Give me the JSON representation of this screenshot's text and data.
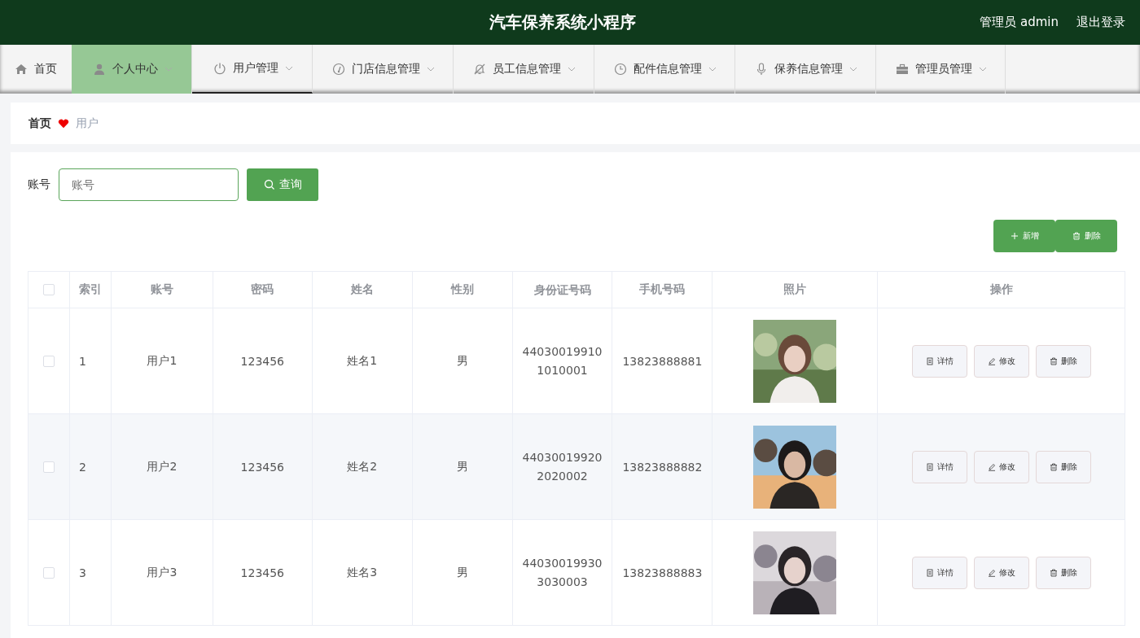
{
  "header": {
    "title": "汽车保养系统小程序",
    "user": "管理员 admin",
    "logout": "退出登录"
  },
  "nav": [
    {
      "label": "首页",
      "dropdown": false,
      "selected": false,
      "highlighted": false
    },
    {
      "label": "个人中心",
      "dropdown": true,
      "selected": false,
      "highlighted": true
    },
    {
      "label": "用户管理",
      "dropdown": true,
      "selected": true,
      "highlighted": false
    },
    {
      "label": "门店信息管理",
      "dropdown": true,
      "selected": false,
      "highlighted": false
    },
    {
      "label": "员工信息管理",
      "dropdown": true,
      "selected": false,
      "highlighted": false
    },
    {
      "label": "配件信息管理",
      "dropdown": true,
      "selected": false,
      "highlighted": false
    },
    {
      "label": "保养信息管理",
      "dropdown": true,
      "selected": false,
      "highlighted": false
    },
    {
      "label": "管理员管理",
      "dropdown": true,
      "selected": false,
      "highlighted": false
    }
  ],
  "breadcrumb": [
    "首页",
    "用户"
  ],
  "search": {
    "label": "账号",
    "placeholder": "账号",
    "button": "查询"
  },
  "actions": {
    "add": "新增",
    "delete": "删除"
  },
  "table": {
    "select_all_checked": false,
    "columns": [
      "索引",
      "账号",
      "密码",
      "姓名",
      "性别",
      "身份证号码",
      "手机号码",
      "照片",
      "操作"
    ],
    "rows": [
      {
        "checked": false,
        "cells": [
          "1",
          "用户1",
          "123456",
          "姓名1",
          "男",
          "440300199101010001",
          "13823888881"
        ],
        "photo": {
          "kind": "picture"
        },
        "buttons": [
          "详情",
          "修改",
          "删除"
        ]
      },
      {
        "checked": false,
        "cells": [
          "2",
          "用户2",
          "123456",
          "姓名2",
          "男",
          "440300199202020002",
          "13823888882"
        ],
        "photo": {
          "kind": "picture"
        },
        "buttons": [
          "详情",
          "修改",
          "删除"
        ]
      },
      {
        "checked": false,
        "cells": [
          "3",
          "用户3",
          "123456",
          "姓名3",
          "男",
          "440300199303030003",
          "13823888883"
        ],
        "photo": {
          "kind": "picture"
        },
        "buttons": [
          "详情",
          "修改",
          "删除"
        ]
      }
    ]
  }
}
